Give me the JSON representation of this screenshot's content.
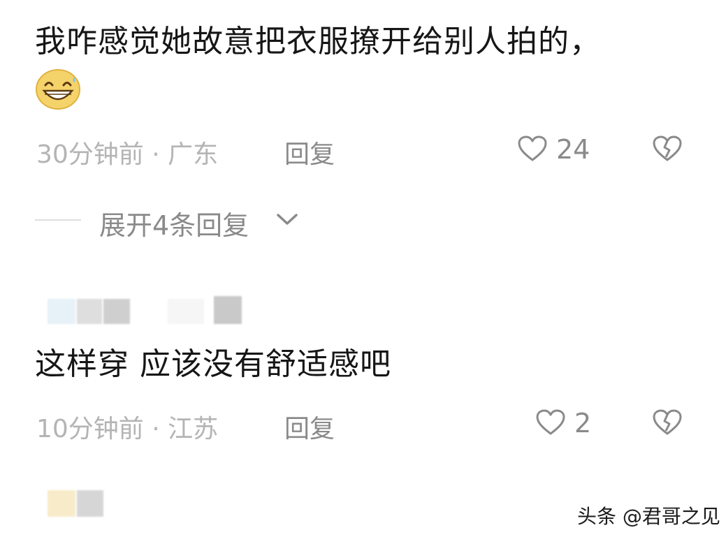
{
  "comments": [
    {
      "text": "我咋感觉她故意把衣服撩开给别人拍的，",
      "emoji": "grinning-sweat-emoji",
      "meta": "30分钟前 · 广东",
      "reply_label": "回复",
      "likes": "24",
      "expand_label": "展开4条回复"
    },
    {
      "text": "这样穿 应该没有舒适感吧",
      "meta": "10分钟前 · 江苏",
      "reply_label": "回复",
      "likes": "2"
    }
  ],
  "watermark": "头条 @君哥之见",
  "colors": {
    "meta_gray": "#b4b4b4",
    "action_gray": "#8a8a8a",
    "text": "#161616",
    "emoji_fill": "#f5d36b"
  },
  "icons": {
    "like": "heart-outline-icon",
    "dislike": "broken-heart-icon",
    "expand": "chevron-down-icon"
  }
}
